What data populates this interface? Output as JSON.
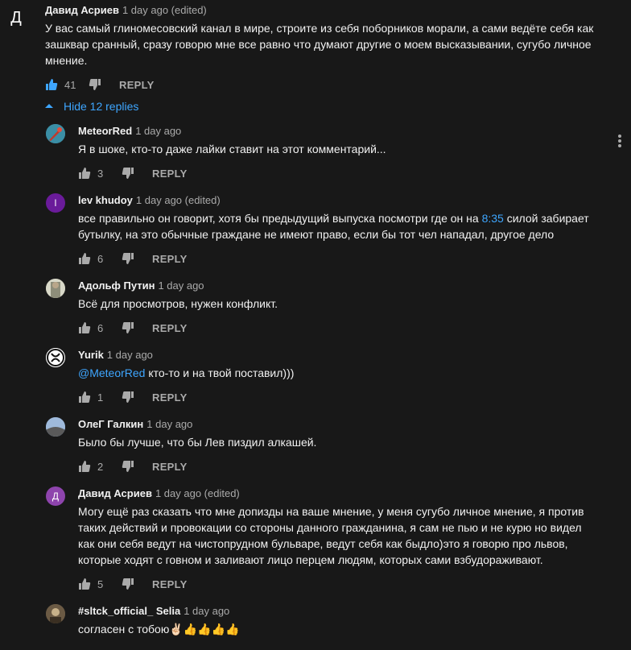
{
  "top_comment": {
    "avatar_letter": "Д",
    "avatar_color": "#8e44ad",
    "author": "Давид Асриев",
    "meta": "1 day ago (edited)",
    "lines": [
      "У вас самый глиномесовский канал в мире, строите из себя поборников морали, а сами ведёте себя как",
      "зашквар сранный, сразу говорю мне все равно что думают другие о моем высказывании, сугубо личное",
      "мнение."
    ],
    "likes": "41",
    "reply_label": "REPLY"
  },
  "hide_replies_label": "Hide 12 replies",
  "replies": [
    {
      "author": "MeteorRed",
      "meta": "1 day ago",
      "avatar_kind": "image",
      "avatar_colors": [
        "#3b8ea5",
        "#c0392b"
      ],
      "lines": [
        "Я в шоке, кто-то даже лайки ставит на этот комментарий..."
      ],
      "likes": "3",
      "reply_label": "REPLY"
    },
    {
      "author": "lev khudoy",
      "meta": "1 day ago (edited)",
      "avatar_kind": "letter",
      "avatar_letter": "l",
      "avatar_colors": [
        "#6a1b9a"
      ],
      "lines": [
        "все правильно он говорит, хотя бы предыдущий выпуска посмотри где он на",
        "бутылку, на это обычные граждане не имеют право, если бы тот чел нападал, другое дело"
      ],
      "timestamp_link": "8:35",
      "line1_after": " силой забирает",
      "likes": "6",
      "reply_label": "REPLY"
    },
    {
      "author": "Адольф Путин",
      "meta": "1 day ago",
      "avatar_kind": "image",
      "avatar_colors": [
        "#8d8d7a",
        "#d8d8c8"
      ],
      "lines": [
        "Всё для просмотров, нужен конфликт."
      ],
      "likes": "6",
      "reply_label": "REPLY"
    },
    {
      "author": "Yurik",
      "meta": "1 day ago",
      "avatar_kind": "image",
      "avatar_colors": [
        "#ffffff",
        "#111111"
      ],
      "mention": "@MeteorRed",
      "lines": [
        " кто-то и на твой поставил)))"
      ],
      "likes": "1",
      "reply_label": "REPLY"
    },
    {
      "author": "ОлеГ Галкин",
      "meta": "1 day ago",
      "avatar_kind": "image",
      "avatar_colors": [
        "#7a9cc2",
        "#5a5a5a"
      ],
      "lines": [
        "Было бы лучше, что бы Лев пиздил алкашей."
      ],
      "likes": "2",
      "reply_label": "REPLY"
    },
    {
      "author": "Давид Асриев",
      "meta": "1 day ago (edited)",
      "avatar_kind": "letter",
      "avatar_letter": "Д",
      "avatar_colors": [
        "#8e44ad"
      ],
      "lines": [
        "Могу ещё раз сказать что мне допизды на ваше мнение, у меня сугубо личное мнение, я против",
        "таких действий и провокации со стороны данного гражданина, я сам не пью и не курю но видел",
        "как они себя ведут на чистопрудном бульваре, ведут себя как быдло)это я говорю про львов,",
        "которые ходят с говном и заливают лицо перцем людям, которых сами взбудораживают."
      ],
      "likes": "5",
      "reply_label": "REPLY"
    },
    {
      "author": "#sltck_official_ Selia",
      "meta": "1 day ago",
      "avatar_kind": "image",
      "avatar_colors": [
        "#6b5a44",
        "#c9b28a"
      ],
      "lines": [
        "согласен с тобою✌🏻👍👍👍👍"
      ]
    }
  ]
}
